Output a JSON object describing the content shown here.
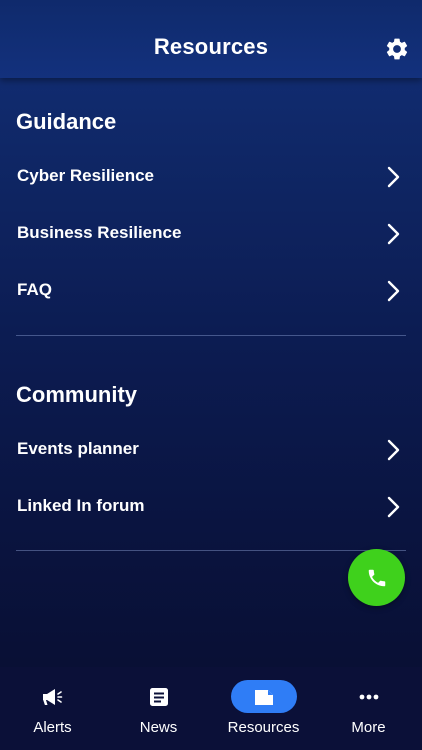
{
  "header": {
    "title": "Resources",
    "settings_icon": "gear-icon"
  },
  "sections": [
    {
      "title": "Guidance",
      "items": [
        {
          "label": "Cyber Resilience"
        },
        {
          "label": "Business Resilience"
        },
        {
          "label": "FAQ"
        }
      ]
    },
    {
      "title": "Community",
      "items": [
        {
          "label": "Events planner"
        },
        {
          "label": "Linked In forum"
        }
      ]
    }
  ],
  "fab": {
    "icon": "phone-icon",
    "color": "#3fd11c"
  },
  "tabbar": {
    "active_color": "#2f7df6",
    "tabs": [
      {
        "label": "Alerts",
        "icon": "megaphone-icon",
        "active": false
      },
      {
        "label": "News",
        "icon": "article-icon",
        "active": false
      },
      {
        "label": "Resources",
        "icon": "folder-icon",
        "active": true
      },
      {
        "label": "More",
        "icon": "more-icon",
        "active": false
      }
    ]
  }
}
